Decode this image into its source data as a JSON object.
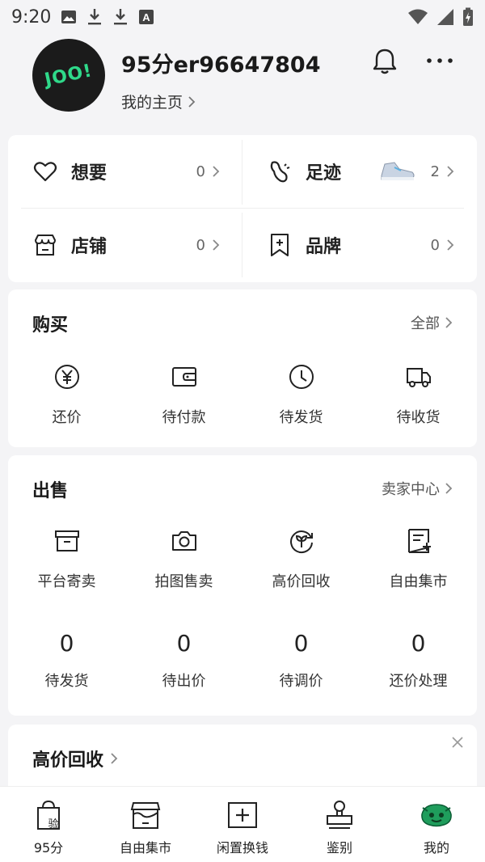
{
  "status_bar": {
    "time": "9:20",
    "icons": [
      "image-icon",
      "download-icon",
      "download-icon",
      "text-a-icon"
    ],
    "right_icons": [
      "wifi-icon",
      "signal-icon",
      "battery-charging-icon"
    ]
  },
  "profile": {
    "avatar_text": "JOO!",
    "username": "95分er96647804",
    "homepage_label": "我的主页"
  },
  "favorites": [
    {
      "label": "想要",
      "count": "0",
      "icon": "heart-icon"
    },
    {
      "label": "足迹",
      "count": "2",
      "icon": "footprint-icon"
    },
    {
      "label": "店铺",
      "count": "0",
      "icon": "store-icon"
    },
    {
      "label": "品牌",
      "count": "0",
      "icon": "bookmark-plus-icon"
    }
  ],
  "buy": {
    "title": "购买",
    "link": "全部",
    "items": [
      {
        "label": "还价",
        "icon": "yuan-circle-icon"
      },
      {
        "label": "待付款",
        "icon": "wallet-icon"
      },
      {
        "label": "待发货",
        "icon": "clock-icon"
      },
      {
        "label": "待收货",
        "icon": "truck-icon"
      }
    ]
  },
  "sell": {
    "title": "出售",
    "link": "卖家中心",
    "items": [
      {
        "label": "平台寄卖",
        "icon": "archive-box-icon"
      },
      {
        "label": "拍图售卖",
        "icon": "camera-icon"
      },
      {
        "label": "高价回收",
        "icon": "recycle-icon"
      },
      {
        "label": "自由集市",
        "icon": "doc-plus-icon"
      }
    ],
    "stats": [
      {
        "value": "0",
        "label": "待发货"
      },
      {
        "value": "0",
        "label": "待出价"
      },
      {
        "value": "0",
        "label": "待调价"
      },
      {
        "value": "0",
        "label": "还价处理"
      }
    ]
  },
  "recycle": {
    "title": "高价回收"
  },
  "tabbar": [
    {
      "label": "95分",
      "icon": "shopping-bag-verify-icon"
    },
    {
      "label": "自由集市",
      "icon": "market-stall-icon"
    },
    {
      "label": "闲置换钱",
      "icon": "plus-box-icon"
    },
    {
      "label": "鉴别",
      "icon": "stamp-icon"
    },
    {
      "label": "我的",
      "icon": "mascot-icon"
    }
  ]
}
